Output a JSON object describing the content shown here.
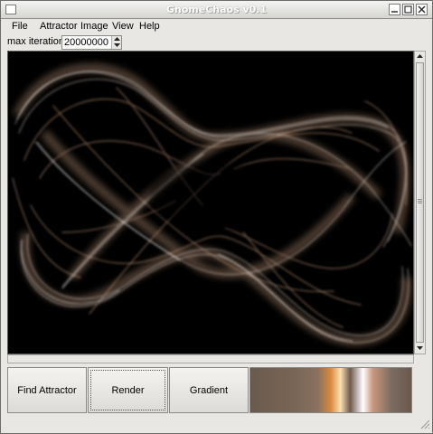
{
  "window": {
    "title": "GnomeChaos v0.1"
  },
  "menubar": {
    "items": [
      "File",
      "Attractor",
      "Image",
      "View",
      "Help"
    ]
  },
  "toolbar": {
    "iterations_label": "max iterations:",
    "iterations_value": "20000000"
  },
  "buttons": {
    "find_attractor": "Find Attractor",
    "render": "Render",
    "gradient": "Gradient"
  },
  "gradient_colors": [
    "#6a5a4e",
    "#7a6656",
    "#8a7060",
    "#d98a40",
    "#fde0b0",
    "#6e5a50",
    "#ffffff",
    "#c89880",
    "#7a6a60",
    "#6a5a4e"
  ],
  "icons": {
    "window_menu": "window-menu-icon",
    "minimize": "minimize-icon",
    "maximize": "maximize-icon",
    "close": "close-icon"
  }
}
